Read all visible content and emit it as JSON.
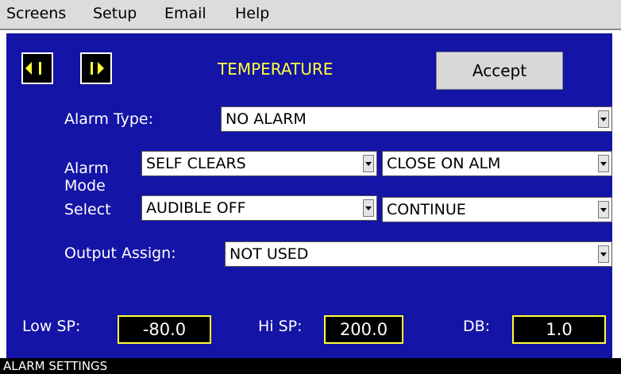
{
  "menu": {
    "screens": "Screens",
    "setup": "Setup",
    "email": "Email",
    "help": "Help"
  },
  "header": {
    "title": "TEMPERATURE",
    "accept_label": "Accept"
  },
  "colors": {
    "panel": "#1414a6",
    "title": "#ffff3a",
    "box_border": "#ffff3a"
  },
  "icons": {
    "prev": "step-back-icon",
    "next": "step-forward-icon"
  },
  "alarm_type": {
    "label": "Alarm Type:",
    "value": "NO ALARM"
  },
  "alarm_mode": {
    "label_line1": "Alarm",
    "label_line2": "Mode",
    "label_line3": "Select",
    "row1_left": "SELF CLEARS",
    "row1_right": "CLOSE ON ALM",
    "row2_left": "AUDIBLE OFF",
    "row2_right": "CONTINUE"
  },
  "output_assign": {
    "label": "Output Assign:",
    "value": "NOT USED"
  },
  "setpoints": {
    "low_label": "Low SP:",
    "low_value": "-80.0",
    "hi_label": "Hi SP:",
    "hi_value": "200.0",
    "db_label": "DB:",
    "db_value": "1.0"
  },
  "status": {
    "text": "ALARM SETTINGS"
  }
}
